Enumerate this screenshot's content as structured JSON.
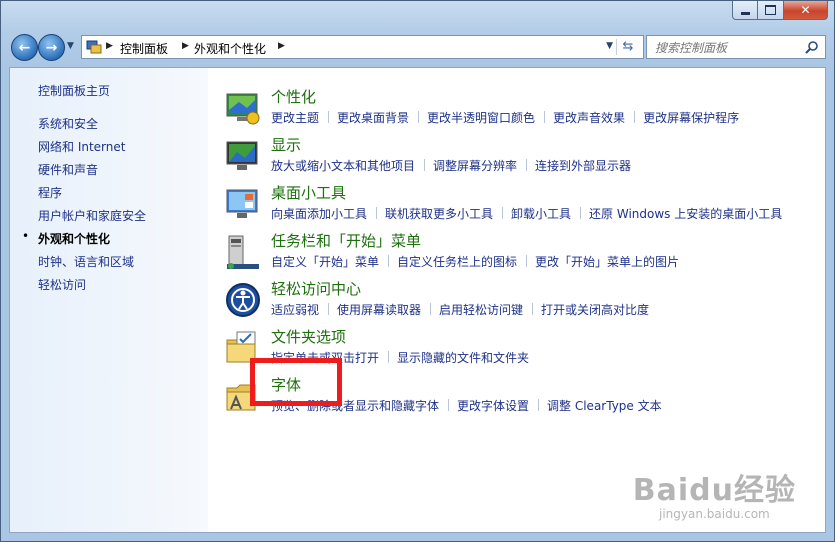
{
  "window": {
    "minimize_icon": "minimize-icon",
    "maximize_icon": "maximize-icon",
    "close_icon": "close-icon"
  },
  "nav": {
    "back_icon": "back-arrow-icon",
    "forward_icon": "forward-arrow-icon",
    "breadcrumbs": [
      "控制面板",
      "外观和个性化"
    ],
    "search_placeholder": "搜索控制面板"
  },
  "sidebar": {
    "items": [
      {
        "label": "控制面板主页"
      },
      {
        "label": "系统和安全"
      },
      {
        "label": "网络和 Internet"
      },
      {
        "label": "硬件和声音"
      },
      {
        "label": "程序"
      },
      {
        "label": "用户帐户和家庭安全"
      },
      {
        "label": "外观和个性化",
        "current": true
      },
      {
        "label": "时钟、语言和区域"
      },
      {
        "label": "轻松访问"
      }
    ]
  },
  "categories": [
    {
      "title": "个性化",
      "icon": "personalization-icon",
      "links": [
        "更改主题",
        "更改桌面背景",
        "更改半透明窗口颜色",
        "更改声音效果",
        "更改屏幕保护程序"
      ]
    },
    {
      "title": "显示",
      "icon": "display-icon",
      "links": [
        "放大或缩小文本和其他项目",
        "调整屏幕分辨率",
        "连接到外部显示器"
      ]
    },
    {
      "title": "桌面小工具",
      "icon": "gadgets-icon",
      "links": [
        "向桌面添加小工具",
        "联机获取更多小工具",
        "卸载小工具",
        "还原 Windows 上安装的桌面小工具"
      ]
    },
    {
      "title": "任务栏和「开始」菜单",
      "icon": "taskbar-icon",
      "links": [
        "自定义「开始」菜单",
        "自定义任务栏上的图标",
        "更改「开始」菜单上的图片"
      ]
    },
    {
      "title": "轻松访问中心",
      "icon": "ease-of-access-icon",
      "links": [
        "适应弱视",
        "使用屏幕读取器",
        "启用轻松访问键",
        "打开或关闭高对比度"
      ]
    },
    {
      "title": "文件夹选项",
      "icon": "folder-options-icon",
      "links": [
        "指定单击或双击打开",
        "显示隐藏的文件和文件夹"
      ]
    },
    {
      "title": "字体",
      "icon": "fonts-folder-icon",
      "links": [
        "预览、删除或者显示和隐藏字体",
        "更改字体设置",
        "调整 ClearType 文本"
      ]
    }
  ],
  "watermark": {
    "main": "Baidu经验",
    "sub": "jingyan.baidu.com"
  },
  "colors": {
    "title_green": "#1e6f0e",
    "link_blue": "#1e3287",
    "highlight_red": "#ef1c1c"
  }
}
